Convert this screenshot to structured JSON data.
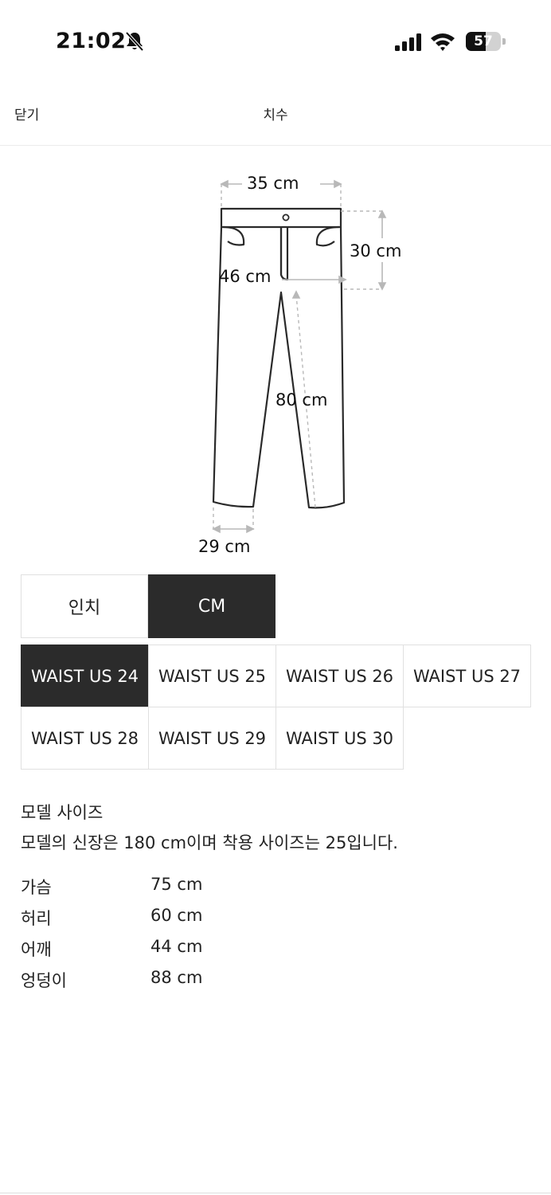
{
  "status_bar": {
    "time": "21:02",
    "battery_level": 57,
    "battery_text": "57"
  },
  "nav": {
    "close_label": "닫기",
    "title": "치수"
  },
  "diagram": {
    "waist_label": "35 cm",
    "rise_label": "30 cm",
    "hip_label": "46 cm",
    "inseam_label": "80 cm",
    "hem_label": "29 cm"
  },
  "unit_tabs": [
    {
      "label": "인치",
      "selected": false
    },
    {
      "label": "CM",
      "selected": true
    }
  ],
  "sizes": [
    {
      "label": "WAIST US 24",
      "selected": true
    },
    {
      "label": "WAIST US 25",
      "selected": false
    },
    {
      "label": "WAIST US 26",
      "selected": false
    },
    {
      "label": "WAIST US 27",
      "selected": false
    },
    {
      "label": "WAIST US 28",
      "selected": false
    },
    {
      "label": "WAIST US 29",
      "selected": false
    },
    {
      "label": "WAIST US 30",
      "selected": false
    }
  ],
  "model": {
    "title": "모델 사이즈",
    "description": "모델의 신장은 180 cm이며 착용 사이즈는 25입니다.",
    "measurements": [
      {
        "label": "가슴",
        "value": "75 cm"
      },
      {
        "label": "허리",
        "value": "60 cm"
      },
      {
        "label": "어깨",
        "value": "44 cm"
      },
      {
        "label": "엉덩이",
        "value": "88 cm"
      }
    ]
  },
  "icons": {
    "bell": "bell-slash-icon",
    "signal": "cellular-signal-icon",
    "wifi": "wifi-icon",
    "battery": "battery-icon"
  }
}
